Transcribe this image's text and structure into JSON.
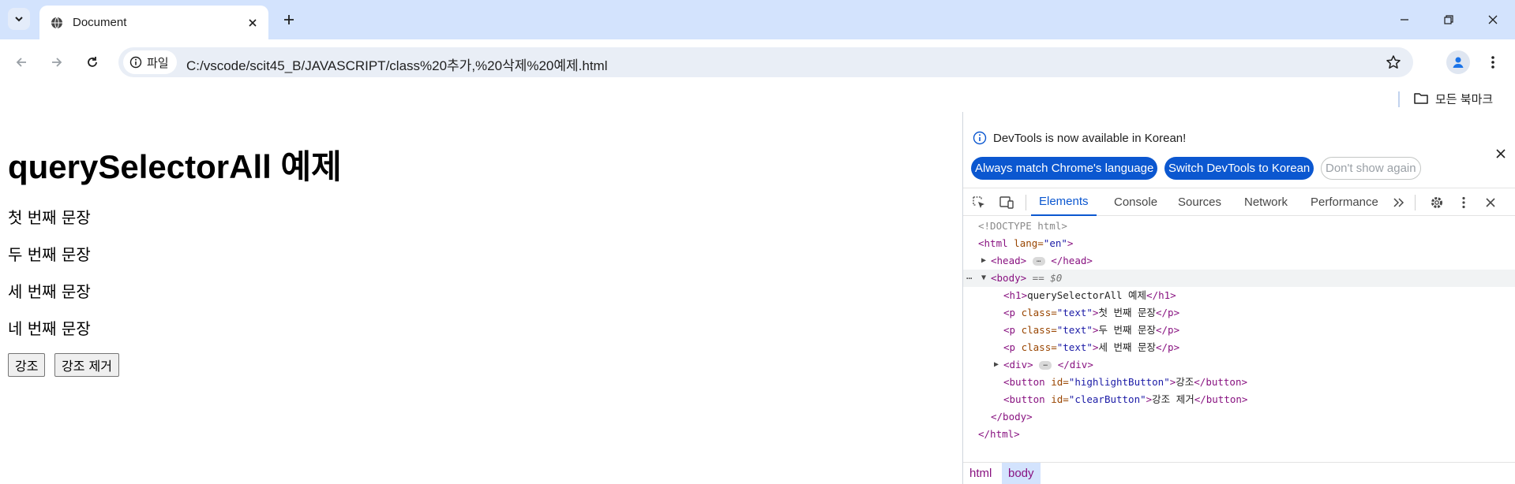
{
  "tab": {
    "title": "Document"
  },
  "address_bar": {
    "chip_label": "파일",
    "url": "C:/vscode/scit45_B/JAVASCRIPT/class%20추가,%20삭제%20예제.html"
  },
  "bookmarks": {
    "all_label": "모든 북마크"
  },
  "page": {
    "heading": "querySelectorAll 예제",
    "paragraphs": [
      "첫 번째 문장",
      "두 번째 문장",
      "세 번째 문장",
      "네 번째 문장"
    ],
    "buttons": {
      "highlight": "강조",
      "clear": "강조 제거"
    }
  },
  "devtools": {
    "info_message": "DevTools is now available in Korean!",
    "info_buttons": {
      "match": "Always match Chrome's language",
      "switch": "Switch DevTools to Korean",
      "dismiss": "Don't show again"
    },
    "tabs": [
      "Elements",
      "Console",
      "Sources",
      "Network",
      "Performance"
    ],
    "active_tab": "Elements",
    "dom": {
      "doctype": "<!DOCTYPE html>",
      "html_open_tag": "<html",
      "lang_attr": " lang=",
      "lang_val": "\"en\"",
      "close_bracket": ">",
      "head_open": "<head>",
      "head_close": "</head>",
      "body_open": "<body>",
      "body_hint": " == $0",
      "h1_open": "<h1>",
      "h1_text": "querySelectorAll 예제",
      "h1_close": "</h1>",
      "p_open": "<p",
      "class_attr": " class=",
      "class_val": "\"text\"",
      "p_close": "</p>",
      "p_texts": [
        "첫 번째 문장",
        "두 번째 문장",
        "세 번째 문장"
      ],
      "div_open": "<div>",
      "div_close": "</div>",
      "button_open": "<button",
      "id_attr": " id=",
      "highlight_id": "\"highlightButton\"",
      "clear_id": "\"clearButton\"",
      "button_close": "</button>",
      "highlight_text": "강조",
      "clear_text": "강조 제거",
      "body_close": "</body>",
      "html_close": "</html>"
    },
    "breadcrumbs": [
      "html",
      "body"
    ]
  },
  "colors": {
    "tabstrip": "#d3e3fd",
    "accent": "#0b57d0",
    "tag": "#881280",
    "attr": "#994500",
    "value": "#1a1aa6"
  }
}
